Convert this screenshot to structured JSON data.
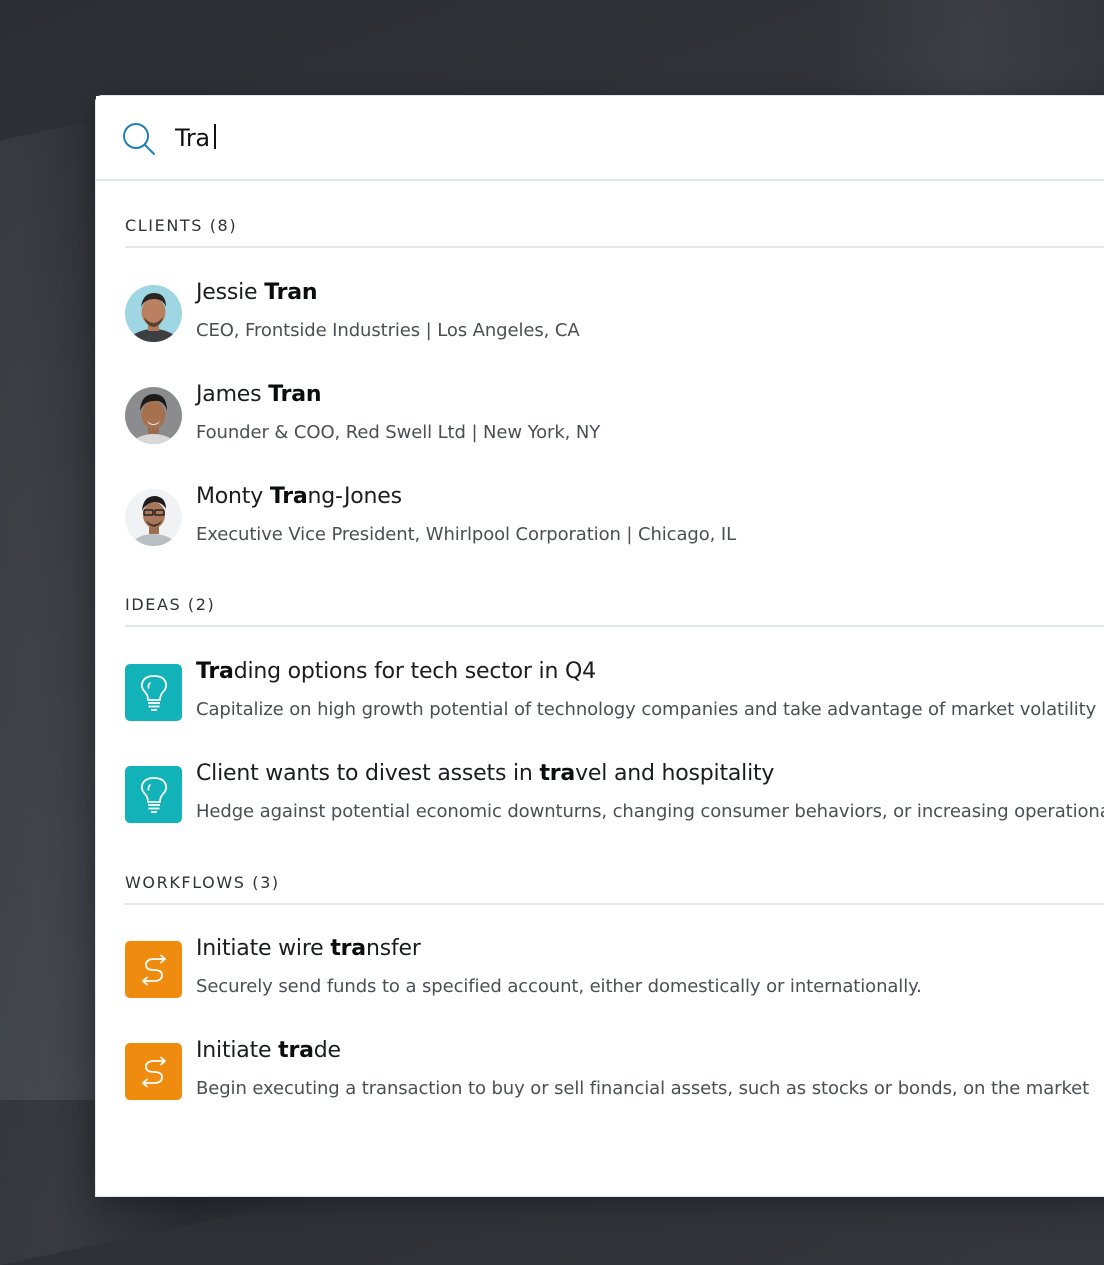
{
  "search": {
    "query": "Tra",
    "icon": "search-icon",
    "accent": "#1f7fb3"
  },
  "sections": {
    "clients": {
      "header": "CLIENTS (8)",
      "items": [
        {
          "name_prefix": "Jessie ",
          "name_match": "Tran",
          "name_suffix": "",
          "details": "CEO, Frontside Industries | Los Angeles, CA",
          "avatar": "avatar-jessie-tran"
        },
        {
          "name_prefix": "James ",
          "name_match": "Tran",
          "name_suffix": "",
          "details": "Founder & COO, Red Swell Ltd | New York, NY",
          "avatar": "avatar-james-tran"
        },
        {
          "name_prefix": "Monty ",
          "name_match": "Tra",
          "name_suffix": "ng-Jones",
          "details": "Executive Vice President, Whirlpool Corporation | Chicago, IL",
          "avatar": "avatar-monty-trang-jones"
        }
      ]
    },
    "ideas": {
      "header": "IDEAS (2)",
      "icon": "lightbulb-icon",
      "color": "#12b3b8",
      "items": [
        {
          "title_prefix": "",
          "title_match": "Tra",
          "title_suffix": "ding options for tech sector in Q4",
          "description": "Capitalize on high growth potential of technology companies and take advantage of market volatility"
        },
        {
          "title_prefix": "Client wants to divest assets in ",
          "title_match": "tra",
          "title_suffix": "vel and hospitality",
          "description": "Hedge against potential economic downturns, changing consumer behaviors, or increasing operational costs"
        }
      ]
    },
    "workflows": {
      "header": "WORKFLOWS (3)",
      "icon": "transfer-arrows-icon",
      "color": "#ef8b0f",
      "items": [
        {
          "title_prefix": "Initiate wire ",
          "title_match": "tra",
          "title_suffix": "nsfer",
          "description": "Securely send funds to a specified account, either domestically or internationally."
        },
        {
          "title_prefix": "Initiate ",
          "title_match": "tra",
          "title_suffix": "de",
          "description": "Begin executing a transaction to buy or sell financial assets, such as stocks or bonds, on the market"
        }
      ]
    }
  }
}
